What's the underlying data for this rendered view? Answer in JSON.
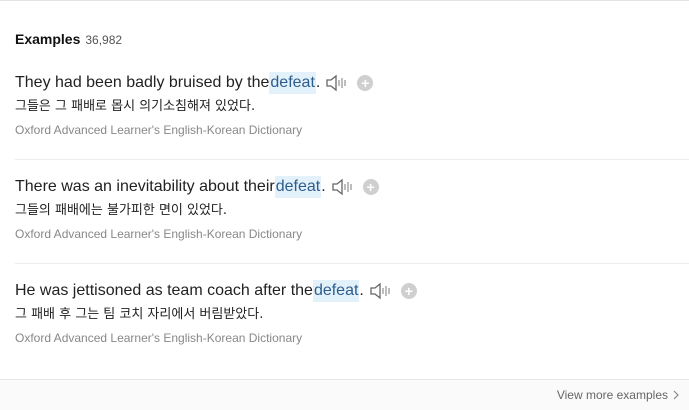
{
  "header": {
    "title": "Examples",
    "count": "36,982"
  },
  "examples": [
    {
      "en_before": "They had been badly bruised by the ",
      "en_highlight": "defeat",
      "en_after": ".",
      "ko": "그들은 그 패배로 몹시 의기소침해져 있었다.",
      "source": "Oxford Advanced Learner's English-Korean Dictionary"
    },
    {
      "en_before": "There was an inevitability about their ",
      "en_highlight": "defeat",
      "en_after": ".",
      "ko": "그들의 패배에는 불가피한 면이 있었다.",
      "source": "Oxford Advanced Learner's English-Korean Dictionary"
    },
    {
      "en_before": "He was jettisoned as team coach after the ",
      "en_highlight": "defeat",
      "en_after": ".",
      "ko": "그 패배 후 그는 팀 코치 자리에서 버림받았다.",
      "source": "Oxford Advanced Learner's English-Korean Dictionary"
    }
  ],
  "icons": {
    "audio": "speaker-icon",
    "add": "plus-icon",
    "more": "chevron-right-icon"
  },
  "footer": {
    "more_label": "View more examples"
  },
  "colors": {
    "highlight_bg": "#e3f1fb",
    "highlight_text": "#2d5d8c",
    "source_text": "#888888"
  }
}
